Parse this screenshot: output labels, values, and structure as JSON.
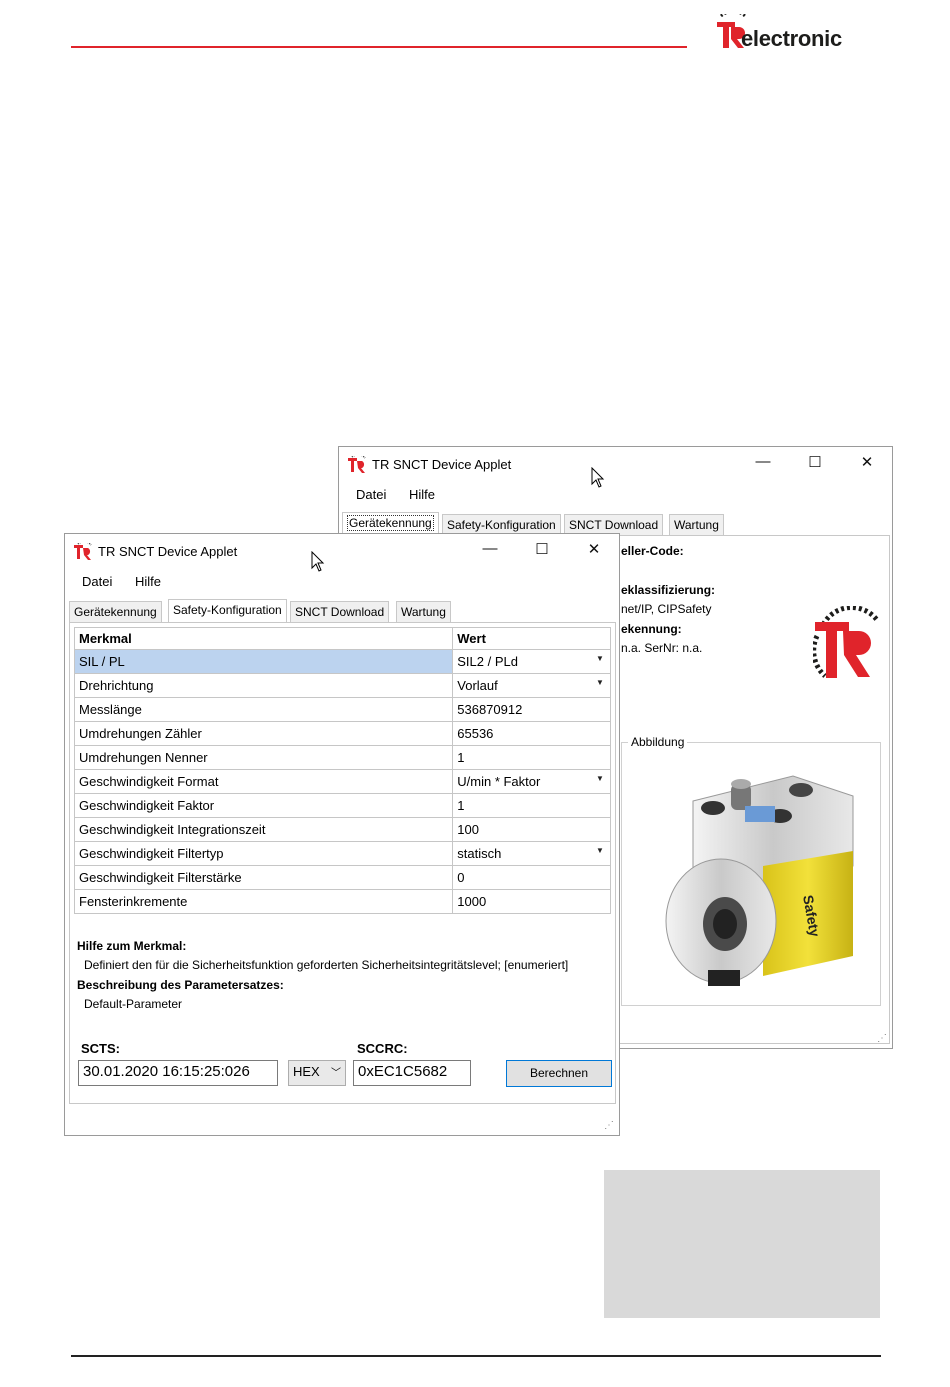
{
  "brand": {
    "logo_text": "electronic",
    "logo_letters": "TR"
  },
  "colors": {
    "brand_red": "#e0242b",
    "selection": "#bcd3ef",
    "button_border": "#0078d7"
  },
  "back_window": {
    "title": "TR SNCT Device Applet",
    "controls": {
      "minimize": "—",
      "maximize": "☐",
      "close": "✕"
    },
    "menu": [
      "Datei",
      "Hilfe"
    ],
    "tabs": [
      "Gerätekennung",
      "Safety-Konfiguration",
      "SNCT Download",
      "Wartung"
    ],
    "active_tab": "Gerätekennung",
    "fields": [
      {
        "label": "eller-Code:",
        "value": ""
      },
      {
        "label": "eklassifizierung:",
        "value": "net/IP, CIPSafety"
      },
      {
        "label": "ekennung:",
        "value": "n.a. SerNr: n.a."
      }
    ],
    "image_group_title": "Abbildung",
    "product_label": "Safety"
  },
  "front_window": {
    "title": "TR SNCT Device Applet",
    "controls": {
      "minimize": "—",
      "maximize": "☐",
      "close": "✕"
    },
    "menu": [
      "Datei",
      "Hilfe"
    ],
    "tabs": [
      "Gerätekennung",
      "Safety-Konfiguration",
      "SNCT Download",
      "Wartung"
    ],
    "active_tab": "Safety-Konfiguration",
    "table": {
      "headers": [
        "Merkmal",
        "Wert"
      ],
      "rows": [
        {
          "key": "SIL / PL",
          "value": "SIL2 / PLd",
          "dropdown": true,
          "selected": true
        },
        {
          "key": "Drehrichtung",
          "value": "Vorlauf",
          "dropdown": true
        },
        {
          "key": "Messlänge",
          "value": "536870912"
        },
        {
          "key": "Umdrehungen Zähler",
          "value": "65536"
        },
        {
          "key": "Umdrehungen Nenner",
          "value": "1"
        },
        {
          "key": "Geschwindigkeit Format",
          "value": "U/min * Faktor",
          "dropdown": true
        },
        {
          "key": "Geschwindigkeit Faktor",
          "value": "1"
        },
        {
          "key": "Geschwindigkeit Integrationszeit",
          "value": "100"
        },
        {
          "key": "Geschwindigkeit Filtertyp",
          "value": "statisch",
          "dropdown": true
        },
        {
          "key": "Geschwindigkeit Filterstärke",
          "value": "0"
        },
        {
          "key": "Fensterinkremente",
          "value": "1000"
        }
      ]
    },
    "help": {
      "title": "Hilfe zum Merkmal:",
      "text": "Definiert den für die Sicherheitsfunktion geforderten Sicherheitsintegritätslevel; [enumeriert]",
      "desc_title": "Beschreibung des Parametersatzes:",
      "desc_text": "Default-Parameter"
    },
    "scts": {
      "label": "SCTS:",
      "value": "30.01.2020 16:15:25:026"
    },
    "format_select": "HEX",
    "sccrc": {
      "label": "SCCRC:",
      "value": "0xEC1C5682"
    },
    "calc_button": "Berechnen"
  }
}
